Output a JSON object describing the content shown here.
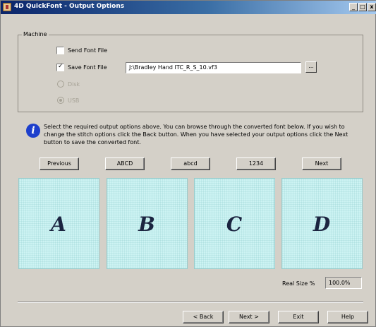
{
  "window": {
    "title": "4D QuickFont - Output Options",
    "minimize": "_",
    "maximize": "□",
    "close": "x"
  },
  "machine": {
    "group_label": "Machine",
    "send_font_file": {
      "label": "Send Font File",
      "checked": false
    },
    "save_font_file": {
      "label": "Save Font File",
      "checked": true
    },
    "file_path": "J:\\Bradley Hand ITC_R_S_10.vf3",
    "browse_label": "...",
    "disk": {
      "label": "Disk",
      "selected": false,
      "enabled": false
    },
    "usb": {
      "label": "USB",
      "selected": true,
      "enabled": false
    }
  },
  "info": {
    "icon": "info-icon",
    "text": "Select the required output options above. You can browse through the converted font below. If you wish to change the stitch options click the Back button. When you have selected your output options click the Next button to save the converted font."
  },
  "browse_buttons": {
    "previous": "Previous",
    "upper": "ABCD",
    "lower": "abcd",
    "digits": "1234",
    "next": "Next"
  },
  "glyph_panels": [
    "A",
    "B",
    "C",
    "D"
  ],
  "real_size": {
    "label": "Real Size %",
    "value": "100.0%"
  },
  "footer": {
    "back": "< Back",
    "next": "Next >",
    "exit": "Exit",
    "help": "Help"
  }
}
